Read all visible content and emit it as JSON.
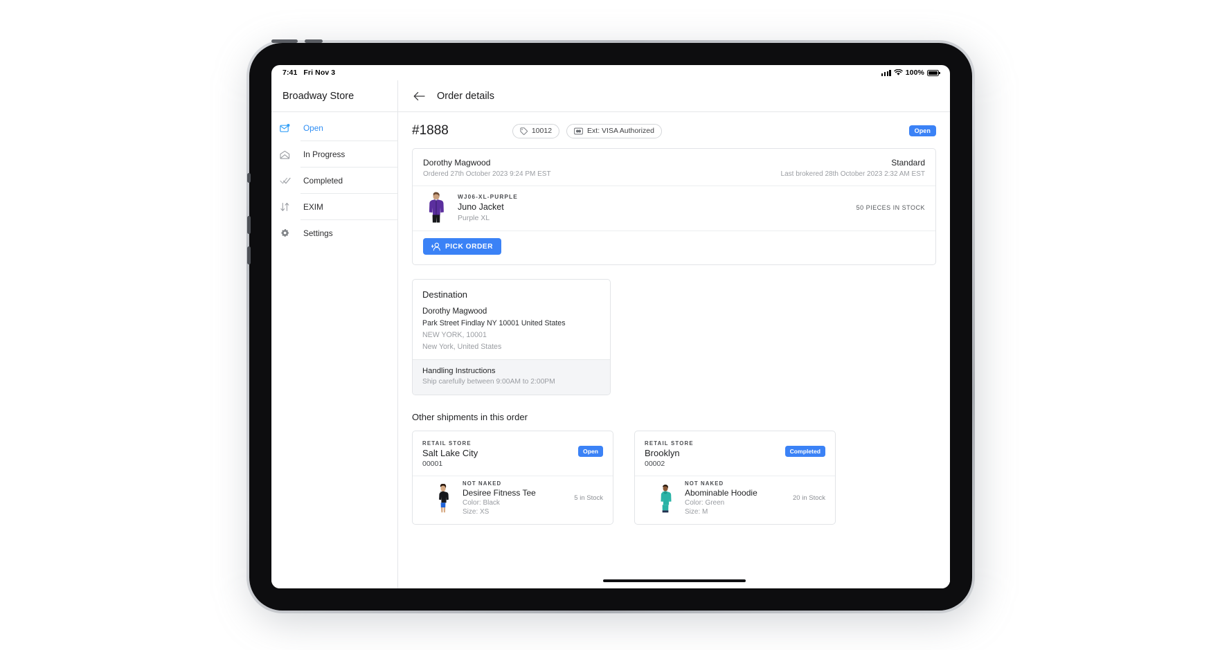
{
  "status_bar": {
    "time": "7:41",
    "date": "Fri Nov 3",
    "battery_percent": "100%",
    "signal_icon": "cellular-signal-icon",
    "wifi_icon": "wifi-icon",
    "battery_icon": "battery-full-icon"
  },
  "sidebar": {
    "title": "Broadway Store",
    "items": [
      {
        "label": "Open",
        "icon": "mail-unread-icon",
        "active": true
      },
      {
        "label": "In Progress",
        "icon": "mail-open-icon",
        "active": false
      },
      {
        "label": "Completed",
        "icon": "double-check-icon",
        "active": false
      },
      {
        "label": "EXIM",
        "icon": "arrows-updown-icon",
        "active": false
      },
      {
        "label": "Settings",
        "icon": "gear-icon",
        "active": false
      }
    ]
  },
  "header": {
    "back_icon": "arrow-left-icon",
    "title": "Order details"
  },
  "order": {
    "number": "#1888",
    "chips": [
      {
        "label": "10012",
        "icon": "tag-icon"
      },
      {
        "label": "Ext: VISA Authorized",
        "icon": "credit-card-icon"
      }
    ],
    "status_badge": "Open",
    "customer_name": "Dorothy Magwood",
    "ordered_text": "Ordered 27th October 2023 9:24 PM EST",
    "shipping_method": "Standard",
    "brokered_text": "Last brokered 28th October 2023 2:32 AM EST",
    "item": {
      "sku": "WJ06-XL-PURPLE",
      "name": "Juno Jacket",
      "variant": "Purple XL",
      "stock": "50 PIECES IN STOCK",
      "thumb_alt": "purple-jacket-thumbnail"
    },
    "pick_button": {
      "label": "PICK ORDER",
      "icon": "person-add-icon"
    }
  },
  "destination": {
    "title": "Destination",
    "name": "Dorothy Magwood",
    "address_line1": "Park Street Findlay NY 10001 United States",
    "address_line2": "NEW YORK, 10001",
    "address_line3": "New York, United States",
    "handling_title": "Handling Instructions",
    "handling_text": "Ship carefully between 9:00AM to 2:00PM"
  },
  "other_shipments": {
    "title": "Other shipments in this order",
    "cards": [
      {
        "store_label": "RETAIL STORE",
        "store_name": "Salt Lake City",
        "store_code": "00001",
        "status": "Open",
        "brand": "NOT NAKED",
        "product_name": "Desiree Fitness Tee",
        "color": "Color: Black",
        "size": "Size: XS",
        "stock": "5 in Stock",
        "thumb_alt": "black-tee-thumbnail"
      },
      {
        "store_label": "RETAIL STORE",
        "store_name": "Brooklyn",
        "store_code": "00002",
        "status": "Completed",
        "brand": "NOT NAKED",
        "product_name": "Abominable Hoodie",
        "color": "Color: Green",
        "size": "Size: M",
        "stock": "20 in Stock",
        "thumb_alt": "green-hoodie-thumbnail"
      }
    ]
  },
  "colors": {
    "accent": "#3b82f6",
    "active_nav": "#2f8ef4",
    "muted": "#9a9da2",
    "border": "#e2e4e7"
  }
}
